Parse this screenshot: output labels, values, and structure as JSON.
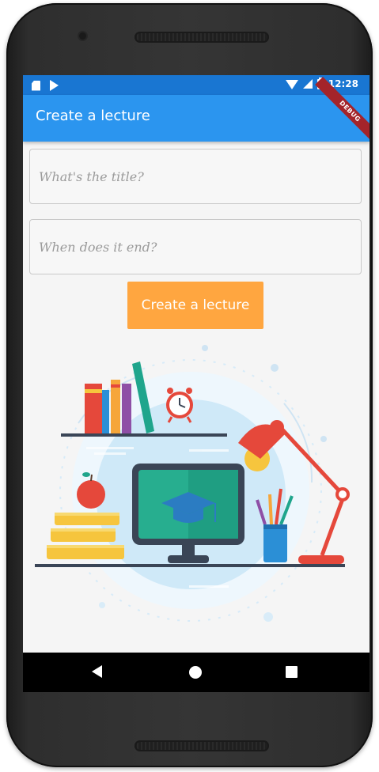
{
  "status_bar": {
    "time": "12:28",
    "icons": [
      "sim-card-icon",
      "play-store-icon",
      "wifi-icon",
      "cell-signal-icon",
      "battery-icon"
    ]
  },
  "app_bar": {
    "title": "Create a lecture",
    "debug_banner": "DEBUG",
    "color": "#2b95ef"
  },
  "form": {
    "title_field": {
      "value": "",
      "placeholder": "What's the title?"
    },
    "end_field": {
      "value": "",
      "placeholder": "When does it end?"
    },
    "submit_label": "Create a lecture",
    "submit_color": "#ffa640"
  },
  "illustration": {
    "name": "desk-education-illustration",
    "icons": [
      "books-icon",
      "alarm-clock-icon",
      "apple-icon",
      "monitor-graduation-cap-icon",
      "pencil-cup-icon",
      "desk-lamp-icon"
    ]
  },
  "nav_bar": {
    "icons": [
      "back-icon",
      "home-icon",
      "recents-icon"
    ]
  }
}
